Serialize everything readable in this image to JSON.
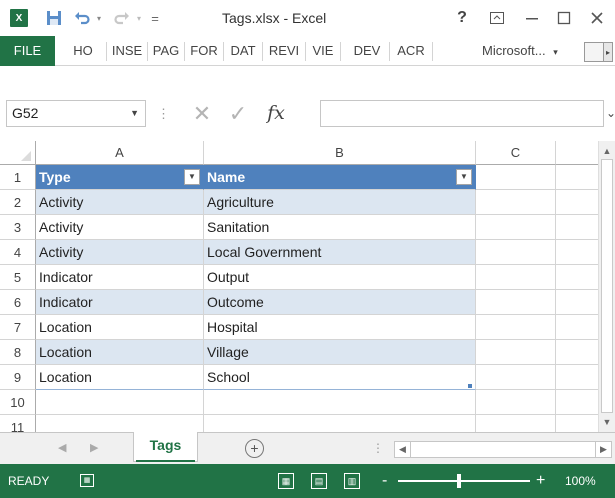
{
  "window": {
    "title": "Tags.xlsx - Excel",
    "app_icon": "excel-logo",
    "app_icon_text": "x∄",
    "help": "?",
    "controls": {
      "restore_ribbon": "▭",
      "minimize": "—",
      "maximize": "☐",
      "close": "✕"
    }
  },
  "quick_access": {
    "save_icon": "save-icon",
    "undo_icon": "undo-icon",
    "redo_icon": "redo-icon",
    "customize": "="
  },
  "ribbon": {
    "file_tab": "FILE",
    "tabs": [
      "HO",
      "INSE",
      "PAG",
      "FOR",
      "DAT",
      "REVI",
      "VIE",
      "DEV",
      "ACR"
    ],
    "account": "Microsoft...",
    "account_arrow": "▾"
  },
  "formula_bar": {
    "name_box": "G52",
    "fx": "fx",
    "value": ""
  },
  "sheet": {
    "columns": [
      "A",
      "B",
      "C"
    ],
    "rows": [
      "1",
      "2",
      "3",
      "4",
      "5",
      "6",
      "7",
      "8",
      "9",
      "10",
      "11"
    ],
    "table_headers": [
      "Type",
      "Name"
    ],
    "table_rows": [
      [
        "Activity",
        "Agriculture"
      ],
      [
        "Activity",
        "Sanitation"
      ],
      [
        "Activity",
        "Local Government"
      ],
      [
        "Indicator",
        "Output"
      ],
      [
        "Indicator",
        "Outcome"
      ],
      [
        "Location",
        "Hospital"
      ],
      [
        "Location",
        "Village"
      ],
      [
        "Location",
        "School"
      ]
    ]
  },
  "sheet_tabs": {
    "active": "Tags",
    "add": "+"
  },
  "status_bar": {
    "ready": "READY",
    "zoom": "100%",
    "zoom_minus": "-",
    "zoom_plus": "+"
  },
  "colors": {
    "accent": "#217346",
    "table_header": "#4f81bd",
    "band": "#dce6f1"
  }
}
